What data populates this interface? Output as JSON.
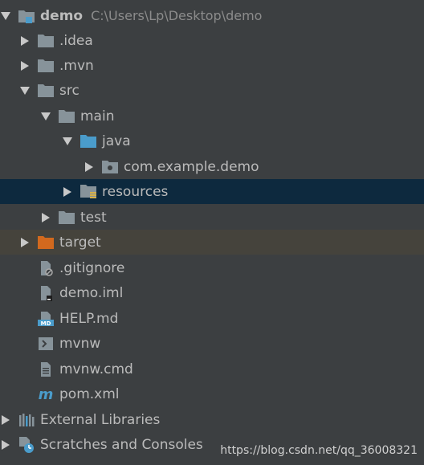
{
  "colors": {
    "background": "#3c3f41",
    "selected_row": "#0d293e",
    "highlight_row": "#45433c",
    "folder": "#87939a",
    "folder_blue": "#4a9ccb",
    "folder_orange": "#d2691e",
    "text": "#bbbbbb",
    "path_text": "#8c8c8c"
  },
  "tree": {
    "root": {
      "label": "demo",
      "path": "C:\\Users\\Lp\\Desktop\\demo",
      "icon": "module-folder-icon"
    },
    "items": [
      {
        "label": ".idea",
        "icon": "folder-icon"
      },
      {
        "label": ".mvn",
        "icon": "folder-icon"
      },
      {
        "label": "src",
        "icon": "folder-icon"
      },
      {
        "label": "main",
        "icon": "folder-icon"
      },
      {
        "label": "java",
        "icon": "source-folder-icon"
      },
      {
        "label": "com.example.demo",
        "icon": "package-icon"
      },
      {
        "label": "resources",
        "icon": "resources-folder-icon"
      },
      {
        "label": "test",
        "icon": "folder-icon"
      },
      {
        "label": "target",
        "icon": "excluded-folder-icon"
      },
      {
        "label": ".gitignore",
        "icon": "ignored-file-icon"
      },
      {
        "label": "demo.iml",
        "icon": "iml-file-icon"
      },
      {
        "label": "HELP.md",
        "icon": "markdown-file-icon"
      },
      {
        "label": "mvnw",
        "icon": "shell-script-icon"
      },
      {
        "label": "mvnw.cmd",
        "icon": "text-file-icon"
      },
      {
        "label": "pom.xml",
        "icon": "maven-icon"
      },
      {
        "label": "External Libraries",
        "icon": "libraries-icon"
      },
      {
        "label": "Scratches and Consoles",
        "icon": "scratches-icon"
      }
    ]
  },
  "watermark": "https://blog.csdn.net/qq_36008321"
}
